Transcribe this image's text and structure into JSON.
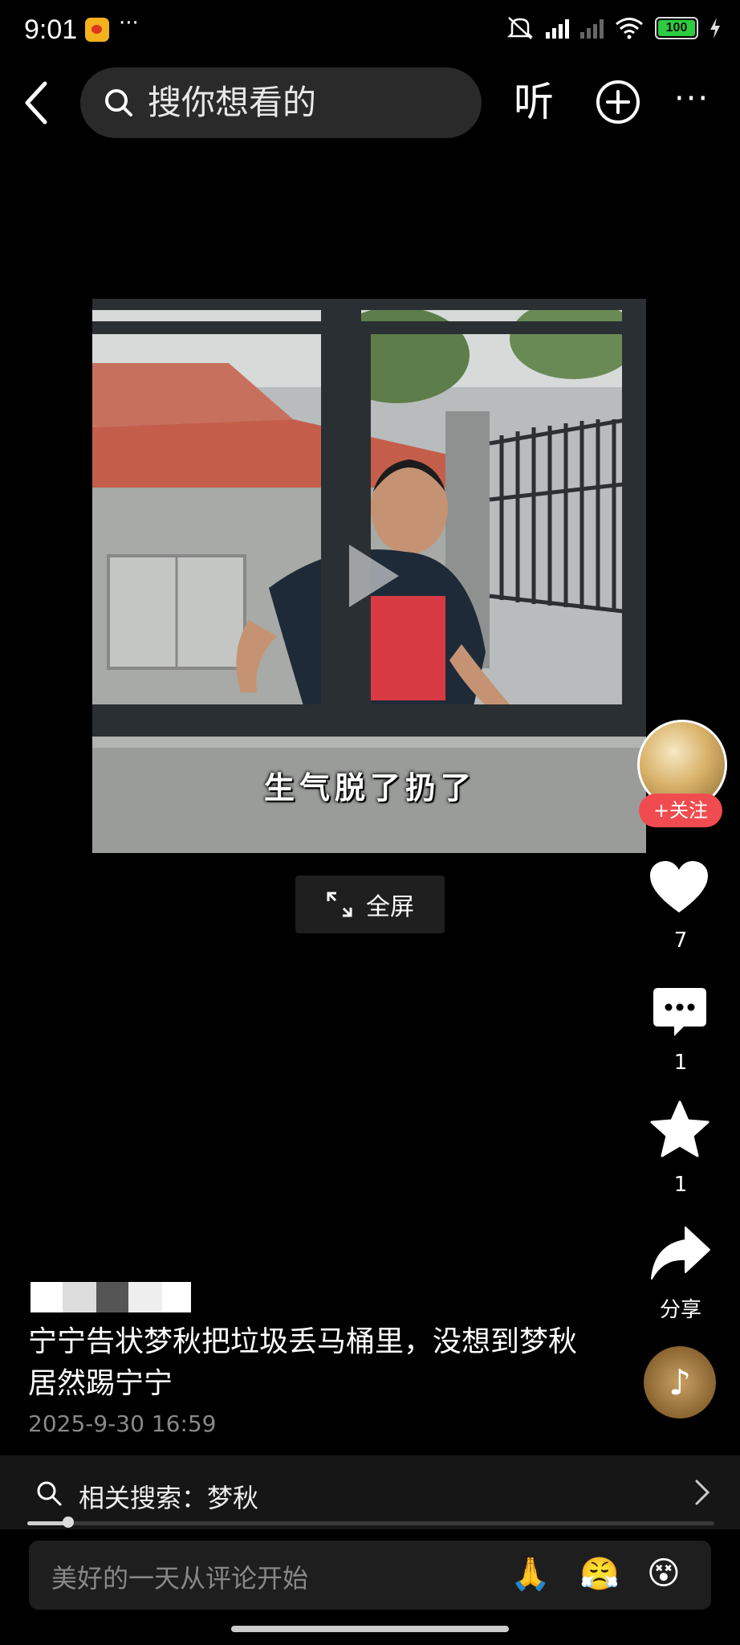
{
  "status_bar": {
    "time": "9:01",
    "notif_more": "···",
    "battery": "100"
  },
  "header": {
    "search_placeholder": "搜你想看的",
    "listen_label": "听",
    "icons": [
      "back-arrow-icon",
      "search-icon",
      "add-circle-icon",
      "more-icon"
    ]
  },
  "video": {
    "subtitle": "生气脱了扔了",
    "fullscreen_label": "全屏"
  },
  "rail": {
    "follow_label": "+关注",
    "like_count": "7",
    "comment_count": "1",
    "favorite_count": "1",
    "share_label": "分享"
  },
  "post": {
    "caption": "宁宁告状梦秋把垃圾丢马桶里，没想到梦秋居然踢宁宁",
    "date": "2025-9-30 16:59"
  },
  "related": {
    "label": "相关搜索：梦秋"
  },
  "playback": {
    "progress_fraction": 0.06
  },
  "comment_bar": {
    "placeholder": "美好的一天从评论开始",
    "emojis": [
      "🙏",
      "😤",
      "😵"
    ]
  },
  "colors": {
    "background": "#000000",
    "follow_red": "#f04c4f",
    "search_box": "#2a2a2a"
  }
}
